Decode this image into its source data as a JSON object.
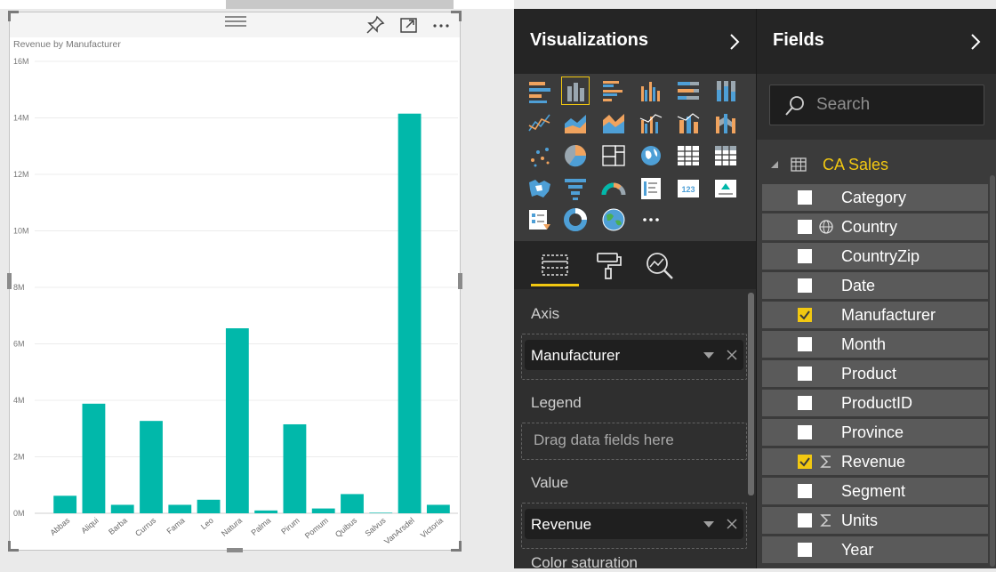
{
  "report": {
    "visual_title": "Revenue by Manufacturer",
    "header_icons": [
      "pin-icon",
      "focus-mode-icon",
      "more-options-icon"
    ]
  },
  "chart_data": {
    "type": "bar",
    "title": "Revenue by Manufacturer",
    "xlabel": "",
    "ylabel": "",
    "categories": [
      "Abbas",
      "Aliqui",
      "Barba",
      "Currus",
      "Fama",
      "Leo",
      "Natura",
      "Palma",
      "Pirum",
      "Pomum",
      "Quibus",
      "Salvus",
      "VanArsdel",
      "Victoria"
    ],
    "values": [
      0.62,
      3.88,
      0.3,
      3.27,
      0.3,
      0.48,
      6.55,
      0.1,
      3.15,
      0.17,
      0.68,
      0.02,
      14.15,
      0.3
    ],
    "value_unit": "M",
    "ylim": [
      0,
      16
    ],
    "yticks": [
      "0M",
      "2M",
      "4M",
      "6M",
      "8M",
      "10M",
      "12M",
      "14M",
      "16M"
    ],
    "grid": true,
    "color": "#01b8aa"
  },
  "visualizations": {
    "title": "Visualizations",
    "icons": [
      "stacked-bar-chart-icon",
      "stacked-column-chart-icon",
      "clustered-bar-chart-icon",
      "clustered-column-chart-icon",
      "100-stacked-bar-chart-icon",
      "100-stacked-column-chart-icon",
      "line-chart-icon",
      "area-chart-icon",
      "stacked-area-chart-icon",
      "line-clustered-column-icon",
      "line-stacked-column-icon",
      "ribbon-chart-icon",
      "scatter-chart-icon",
      "pie-chart-icon",
      "treemap-icon",
      "map-icon",
      "table-icon",
      "matrix-icon",
      "filled-map-icon",
      "funnel-icon",
      "gauge-icon",
      "multi-row-card-icon",
      "card-icon",
      "kpi-icon",
      "slicer-icon",
      "donut-chart-icon",
      "arcgis-map-icon",
      "more-visuals-icon"
    ],
    "selected_icon": "stacked-column-chart-icon",
    "tabs": [
      "fields-tab-icon",
      "format-tab-icon",
      "analytics-tab-icon"
    ],
    "wells": {
      "axis": {
        "label": "Axis",
        "field": "Manufacturer"
      },
      "legend": {
        "label": "Legend",
        "placeholder": "Drag data fields here"
      },
      "value": {
        "label": "Value",
        "field": "Revenue"
      },
      "color_saturation": {
        "label": "Color saturation"
      }
    }
  },
  "fields": {
    "title": "Fields",
    "search_placeholder": "Search",
    "table": "CA Sales",
    "items": [
      {
        "name": "Category",
        "checked": false,
        "icon": ""
      },
      {
        "name": "Country",
        "checked": false,
        "icon": "globe-icon"
      },
      {
        "name": "CountryZip",
        "checked": false,
        "icon": ""
      },
      {
        "name": "Date",
        "checked": false,
        "icon": ""
      },
      {
        "name": "Manufacturer",
        "checked": true,
        "icon": ""
      },
      {
        "name": "Month",
        "checked": false,
        "icon": ""
      },
      {
        "name": "Product",
        "checked": false,
        "icon": ""
      },
      {
        "name": "ProductID",
        "checked": false,
        "icon": ""
      },
      {
        "name": "Province",
        "checked": false,
        "icon": ""
      },
      {
        "name": "Revenue",
        "checked": true,
        "icon": "sigma-icon"
      },
      {
        "name": "Segment",
        "checked": false,
        "icon": ""
      },
      {
        "name": "Units",
        "checked": false,
        "icon": "sigma-icon"
      },
      {
        "name": "Year",
        "checked": false,
        "icon": ""
      }
    ]
  },
  "colors": {
    "accent": "#f2c811",
    "bar": "#01b8aa",
    "pane_dark": "#252525",
    "pane_mid": "#2f2f2f",
    "field_item": "#5a5a5a"
  }
}
